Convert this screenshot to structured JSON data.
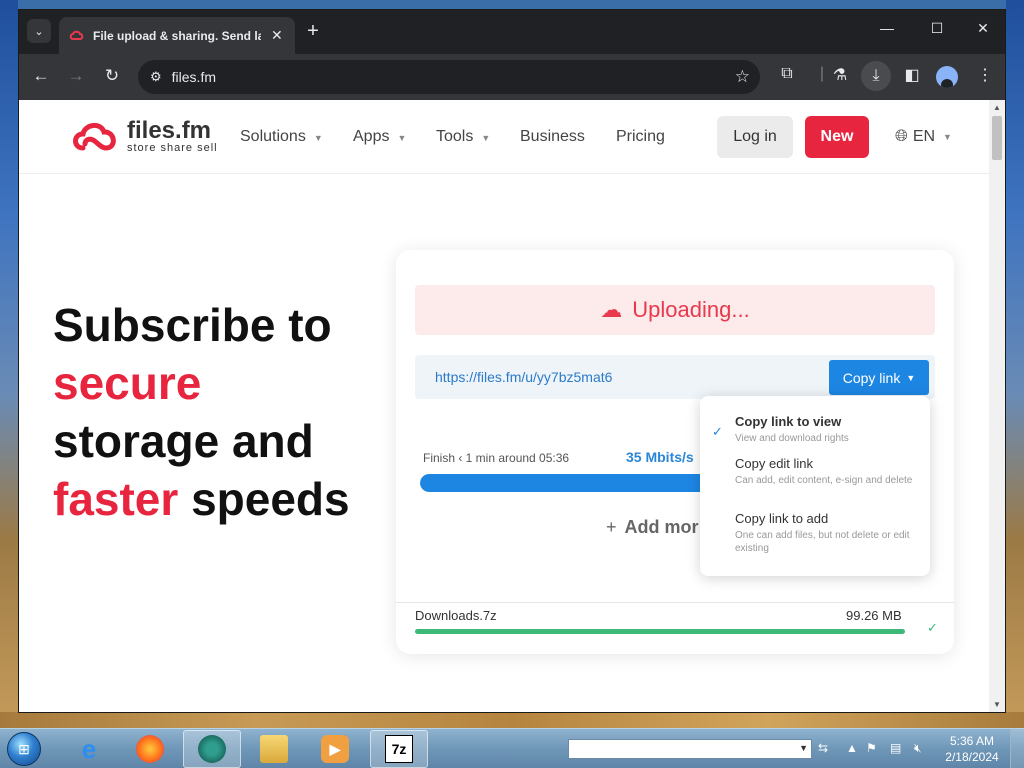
{
  "browser": {
    "tab_title": "File upload & sharing. Send la",
    "tab_close": "✕",
    "new_tab": "+",
    "url": "files.fm",
    "window_controls": {
      "minimize": "—",
      "maximize": "☐",
      "close": "✕"
    }
  },
  "site": {
    "logo_main": "files.fm",
    "logo_sub": "store share sell",
    "nav": [
      {
        "label": "Solutions",
        "dropdown": true
      },
      {
        "label": "Apps",
        "dropdown": true
      },
      {
        "label": "Tools",
        "dropdown": true
      },
      {
        "label": "Business",
        "dropdown": false
      },
      {
        "label": "Pricing",
        "dropdown": false
      }
    ],
    "login_label": "Log in",
    "new_label": "New",
    "lang_label": "EN"
  },
  "hero": {
    "line1": "Subscribe to",
    "line2": "secure",
    "line3": "storage and",
    "line4a": "faster",
    "line4b": " speeds"
  },
  "upload": {
    "status": "Uploading...",
    "link": "https://files.fm/u/yy7bz5mat6",
    "copy_label": "Copy link",
    "finish": "Finish ‹ 1 min around 05:36",
    "speed": "35 Mbits/s",
    "progress_percent": 60,
    "add_more": "Add mor",
    "file_name": "Downloads.7z",
    "file_size": "99.26 MB",
    "file_progress_percent": 100
  },
  "copy_menu": [
    {
      "title": "Copy link to view",
      "desc": "View and download rights",
      "selected": true
    },
    {
      "title": "Copy edit link",
      "desc": "Can add, edit content, e-sign and delete",
      "selected": false
    },
    {
      "title": "Copy link to add",
      "desc": "One can add files, but not delete or edit existing",
      "selected": false
    }
  ],
  "taskbar": {
    "time": "5:36 AM",
    "date": "2/18/2024",
    "app_7z_label": "7z"
  },
  "colors": {
    "brand_red": "#e8253f",
    "link_blue": "#1d86e3",
    "success_green": "#3cb878"
  }
}
